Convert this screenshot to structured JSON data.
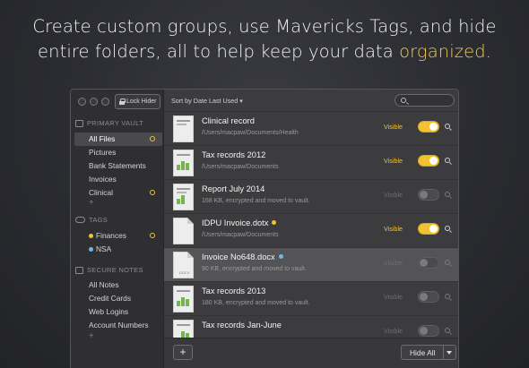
{
  "headline": {
    "line1": "Create custom groups, use Mavericks Tags, and hide",
    "line2_prefix": "entire folders, all to help keep your data ",
    "line2_highlight": "organized",
    "line2_suffix": "."
  },
  "window": {
    "lock_button": "Lock Hider",
    "sort_label": "Sort by Date Last Used ▾",
    "search_placeholder": "",
    "add_button": "+",
    "hide_all_button": "Hide All"
  },
  "sidebar": {
    "vault_header": "PRIMARY VAULT",
    "vault_items": [
      {
        "label": "All Files"
      },
      {
        "label": "Pictures"
      },
      {
        "label": "Bank Statements"
      },
      {
        "label": "Invoices"
      },
      {
        "label": "Clinical"
      }
    ],
    "tags_header": "TAGS",
    "tags": [
      {
        "label": "Finances",
        "color": "#f1c232"
      },
      {
        "label": "NSA",
        "color": "#6fb7e8"
      }
    ],
    "notes_header": "SECURE NOTES",
    "notes_items": [
      {
        "label": "All Notes"
      },
      {
        "label": "Credit Cards"
      },
      {
        "label": "Web Logins"
      },
      {
        "label": "Account Numbers"
      }
    ],
    "add_label": "+"
  },
  "files": [
    {
      "title": "Clinical record",
      "subtitle": "/Users/macpaw/Documents/Health",
      "visibility": "Visible",
      "visible": true,
      "thumb": "sheet"
    },
    {
      "title": "Tax records 2012",
      "subtitle": "/Users/macpaw/Documents",
      "visibility": "Visible",
      "visible": true,
      "thumb": "chart"
    },
    {
      "title": "Report July 2014",
      "subtitle": "168 KB, encrypted and moved to vault.",
      "visibility": "Visible",
      "visible": false,
      "thumb": "chart"
    },
    {
      "title": "IDPU Invoice.dotx",
      "subtitle": "/Users/macpaw/Documents",
      "visibility": "Visible",
      "visible": true,
      "thumb": "doc",
      "tag_color": "#f1c232"
    },
    {
      "title": "Invoice No648.docx",
      "subtitle": "90 KB, encrypted and moved to vault.",
      "visibility": "Visible",
      "visible": false,
      "thumb": "docx",
      "tag_color": "#6fb7e8"
    },
    {
      "title": "Tax records 2013",
      "subtitle": "180 KB, encrypted and moved to vault.",
      "visibility": "Visible",
      "visible": false,
      "thumb": "chart"
    },
    {
      "title": "Tax records Jan-June",
      "subtitle": "",
      "visibility": "Visible",
      "visible": false,
      "thumb": "chart"
    }
  ],
  "colors": {
    "accent": "#f1c232",
    "tag_blue": "#6fb7e8"
  }
}
